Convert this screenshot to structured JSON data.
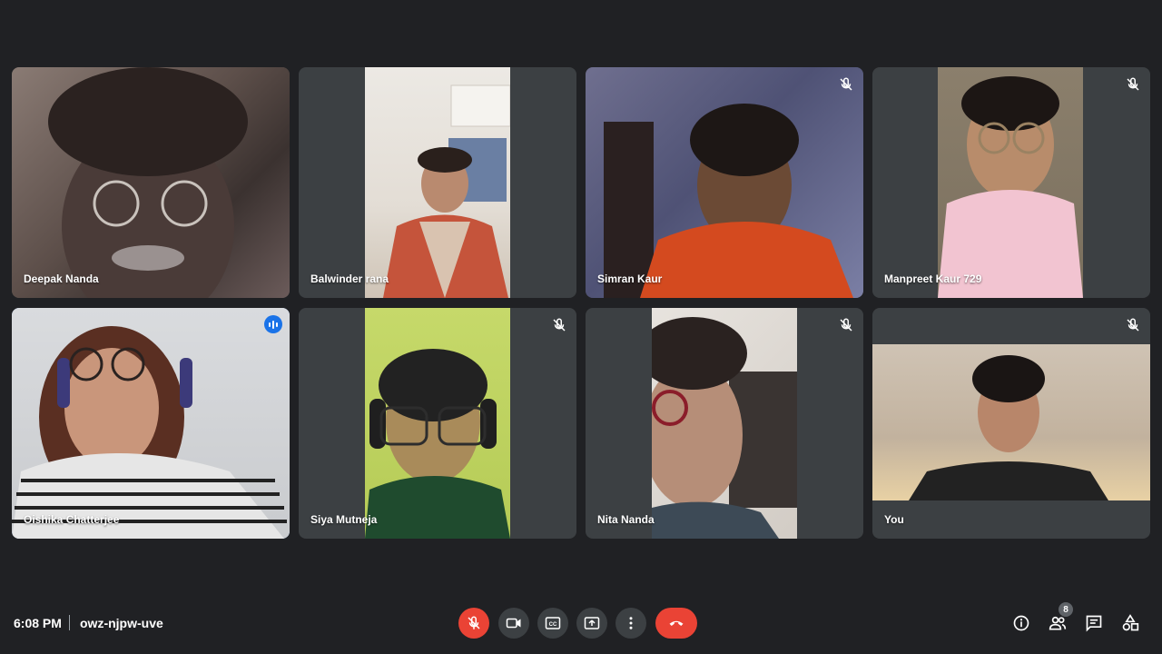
{
  "participants": [
    {
      "name": "Deepak Nanda",
      "muted": false,
      "speaking": false
    },
    {
      "name": "Balwinder rana",
      "muted": false,
      "speaking": false
    },
    {
      "name": "Simran Kaur",
      "muted": true,
      "speaking": false
    },
    {
      "name": "Manpreet Kaur 729",
      "muted": true,
      "speaking": false
    },
    {
      "name": "Oishika Chatterjee",
      "muted": false,
      "speaking": true
    },
    {
      "name": "Siya Mutneja",
      "muted": true,
      "speaking": false
    },
    {
      "name": "Nita Nanda",
      "muted": true,
      "speaking": false
    },
    {
      "name": "You",
      "muted": true,
      "speaking": false
    }
  ],
  "meeting": {
    "time": "6:08 PM",
    "code": "owz-njpw-uve",
    "participant_count": "8"
  },
  "controls": {
    "mic": "mic-off-icon",
    "camera": "camera-icon",
    "captions": "captions-icon",
    "present": "present-screen-icon",
    "more": "more-options-icon",
    "leave": "leave-call-icon"
  },
  "side_controls": [
    "meeting-details-icon",
    "people-icon",
    "chat-icon",
    "activities-icon"
  ],
  "colors": {
    "background": "#202124",
    "tile": "#3c4043",
    "leave": "#ea4335",
    "speaking": "#8ab4f8"
  }
}
